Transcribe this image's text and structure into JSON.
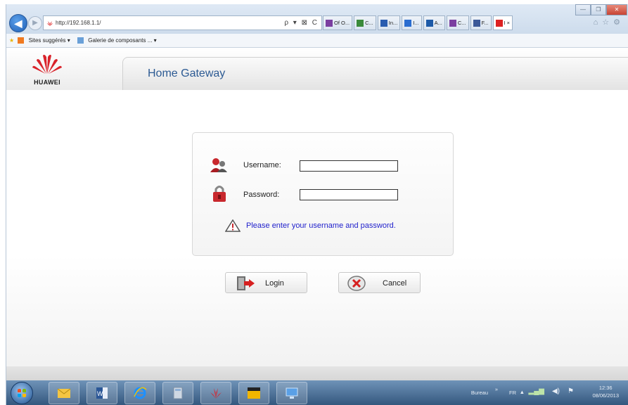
{
  "browser": {
    "url": "http://192.168.1.1/",
    "address_tools": "ρ ▾ ⊠ C",
    "tabs": [
      {
        "label": "Of O...",
        "icon": "of-icon",
        "color": "#7b3fa0"
      },
      {
        "label": "C...",
        "icon": "globe-icon",
        "color": "#3a8a3a"
      },
      {
        "label": "In...",
        "icon": "chart-icon",
        "color": "#2a5db0"
      },
      {
        "label": "I...",
        "icon": "bar-icon",
        "color": "#2a6dd0"
      },
      {
        "label": "A...",
        "icon": "image-icon",
        "color": "#1c5aa8"
      },
      {
        "label": "C...",
        "icon": "of-icon",
        "color": "#7b3fa0"
      },
      {
        "label": "F...",
        "icon": "facebook-icon",
        "color": "#3b5998"
      },
      {
        "label": "I",
        "icon": "huawei-icon",
        "color": "#d22",
        "active": true
      }
    ],
    "favorites": [
      {
        "label": "Sites suggérés ▾"
      },
      {
        "label": "Galerie de composants ... ▾"
      }
    ]
  },
  "page": {
    "brand": "HUAWEI",
    "title": "Home Gateway",
    "username_label": "Username:",
    "password_label": "Password:",
    "username_value": "",
    "password_value": "",
    "message": "Please enter your username and password.",
    "login_label": "Login",
    "cancel_label": "Cancel"
  },
  "taskbar": {
    "tray_text": "Bureau",
    "tray_chevron": "»",
    "language": "FR",
    "time": "12:36",
    "date": "08/06/2013"
  },
  "colors": {
    "title": "#2c5a93",
    "message": "#2222cc",
    "accent_red": "#d9232b"
  }
}
